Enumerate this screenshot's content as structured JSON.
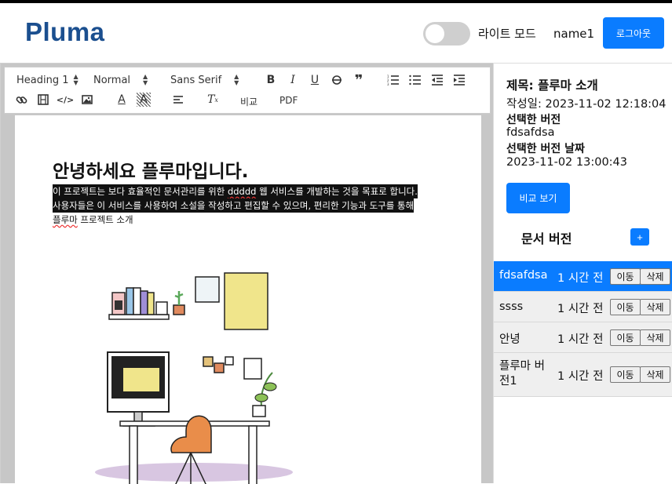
{
  "header": {
    "logo": "Pluma",
    "mode_label": "라이트 모드",
    "username": "name1",
    "logout_label": "로그아웃"
  },
  "toolbar": {
    "heading_select": "Heading 1",
    "size_select": "Normal",
    "font_select": "Sans Serif",
    "compare_label": "비교",
    "pdf_label": "PDF"
  },
  "document": {
    "title": "안녕하세요 플루마입니다.",
    "line1_a": "이 프로젝트는 보다 효율적인 문서관리를 위한 ",
    "line1_b": "ddddd",
    "line1_c": " 웹 서비스를 개발하는 것을 목표로 합니다.",
    "line2": "사용자들은 이 서비스를 사용하여 소설을 작성하고 편집할 수 있으며, 편리한 기능과 도구를 통해",
    "line3_a": "플루마",
    "line3_b": " 프로젝트 소개"
  },
  "panel": {
    "title": "제목: 플루마 소개",
    "created": "작성일: 2023-11-02 12:18:04",
    "selected_version_label": "선택한 버전",
    "selected_version": "fdsafdsa",
    "selected_date_label": "선택한 버전 날짜",
    "selected_date": "2023-11-02 13:00:43",
    "compare_button": "비교 보기",
    "versions_title": "문서 버전",
    "add_label": "+",
    "move_label": "이동",
    "delete_label": "삭제",
    "versions": [
      {
        "name": "fdsafdsa",
        "time": "1 시간 전",
        "active": true
      },
      {
        "name": "ssss",
        "time": "1 시간 전",
        "active": false
      },
      {
        "name": "안녕",
        "time": "1 시간 전",
        "active": false
      },
      {
        "name": "플루마 버\n전1",
        "time": "1 시간 전",
        "active": false
      }
    ]
  },
  "colors": {
    "accent": "#0a7cff",
    "logo": "#1b4f8f",
    "editor_bg": "#c7c7c7"
  }
}
